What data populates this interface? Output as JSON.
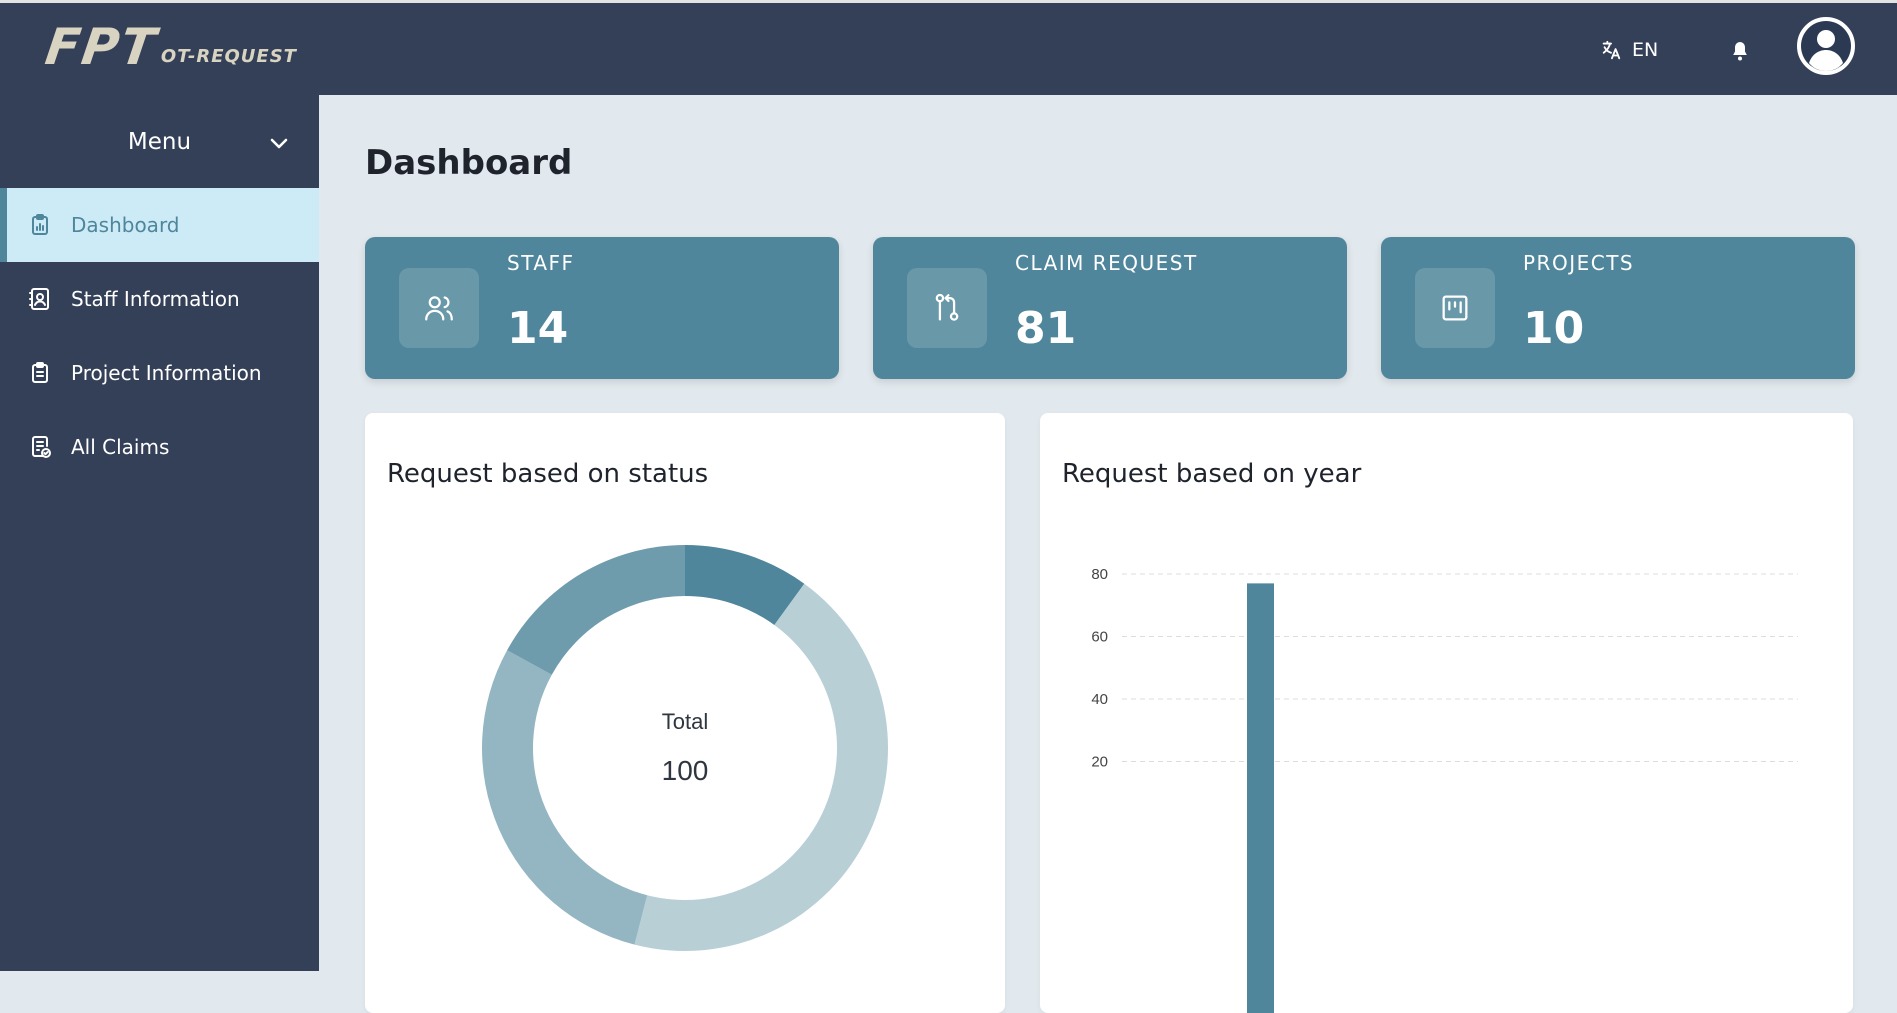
{
  "header": {
    "logo_main": "FPT",
    "logo_sub": "OT-REQUEST",
    "language": "EN",
    "icons": {
      "language": "translate-icon",
      "notifications": "bell-icon",
      "avatar": "user-avatar-icon"
    }
  },
  "sidebar": {
    "menu_label": "Menu",
    "items": [
      {
        "label": "Dashboard",
        "icon": "clipboard-chart-icon",
        "active": true
      },
      {
        "label": "Staff Information",
        "icon": "contact-book-icon",
        "active": false
      },
      {
        "label": "Project Information",
        "icon": "clipboard-list-icon",
        "active": false
      },
      {
        "label": "All Claims",
        "icon": "receipt-check-icon",
        "active": false
      }
    ]
  },
  "main": {
    "title": "Dashboard",
    "stats": [
      {
        "label": "STAFF",
        "value": "14",
        "icon": "users-icon"
      },
      {
        "label": "CLAIM REQUEST",
        "value": "81",
        "icon": "git-pull-request-icon"
      },
      {
        "label": "PROJECTS",
        "value": "10",
        "icon": "kanban-icon"
      }
    ],
    "status_panel": {
      "title": "Request based on status",
      "center_label": "Total",
      "center_value": "100"
    },
    "year_panel": {
      "title": "Request based on year"
    }
  },
  "colors": {
    "navy": "#344058",
    "accent": "#4f869b",
    "background": "#e2e9ee",
    "active_nav_bg": "#cdebf7",
    "logo": "#d9d4c1"
  },
  "chart_data": [
    {
      "type": "pie",
      "variant": "donut",
      "center_text": [
        "Total",
        "100"
      ],
      "slices": [
        {
          "value": 10,
          "color": "#4f869b"
        },
        {
          "value": 44,
          "color": "#b8cfd6"
        },
        {
          "value": 29,
          "color": "#94b6c2"
        },
        {
          "value": 17,
          "color": "#6e9cad"
        }
      ]
    },
    {
      "type": "bar",
      "ylim": [
        0,
        80
      ],
      "yticks": [
        20,
        40,
        60,
        80
      ],
      "grid": true,
      "values": [
        77
      ],
      "bar_color": "#4f869b"
    }
  ]
}
